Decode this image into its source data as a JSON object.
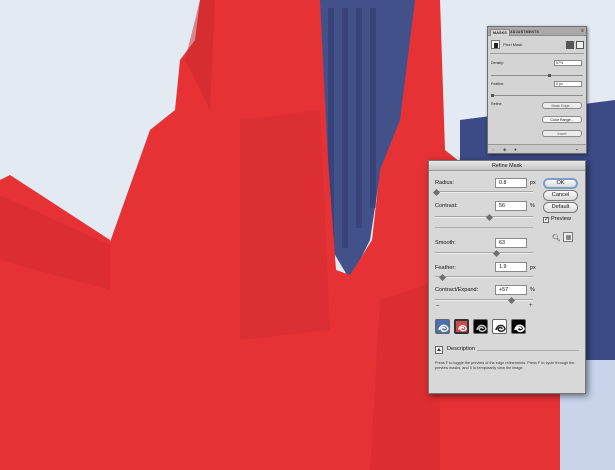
{
  "colors": {
    "mask_red": "#e63235",
    "sky": "#dfe6ef",
    "panel_gray": "#d8d8d8",
    "building_blue": "#43518b"
  },
  "masks_panel": {
    "tabs": [
      "MASKS",
      "ADJUSTMENTS"
    ],
    "title": "Pixel Mask",
    "density_label": "Density:",
    "density_value": "57%",
    "feather_label": "Feather:",
    "feather_value": "0 px",
    "refine_label": "Refine:",
    "buttons": [
      "Mask Edge...",
      "Color Range...",
      "Invert"
    ],
    "menu_icon": "panel-menu-icon"
  },
  "refine_mask": {
    "title": "Refine Mask",
    "radius_label": "Radius:",
    "radius_value": "0.8",
    "radius_unit": "px",
    "contrast_label": "Contrast:",
    "contrast_value": "56",
    "contrast_unit": "%",
    "smooth_label": "Smooth:",
    "smooth_value": "63",
    "feather_label": "Feather:",
    "feather_value": "1.9",
    "feather_unit": "px",
    "contract_label": "Contract/Expand:",
    "contract_value": "+57",
    "contract_unit": "%",
    "minus": "–",
    "plus": "+",
    "ok_label": "OK",
    "cancel_label": "Cancel",
    "default_label": "Default",
    "preview_label": "Preview",
    "preview_checked": true,
    "description_label": "Description",
    "description_text": "Press F to toggle the preview of the edge refinements. Press F to cycle through the preview masks, and X to temporarily view the image.",
    "slider_levels": {
      "radius": 0.02,
      "contrast": 0.56,
      "smooth": 0.63,
      "feather": 0.08,
      "contract_expand": 0.785
    },
    "preview_modes": [
      "standard-preview-icon",
      "quick-mask-preview-icon",
      "on-black-preview-icon",
      "on-white-preview-icon",
      "mask-preview-icon"
    ]
  }
}
